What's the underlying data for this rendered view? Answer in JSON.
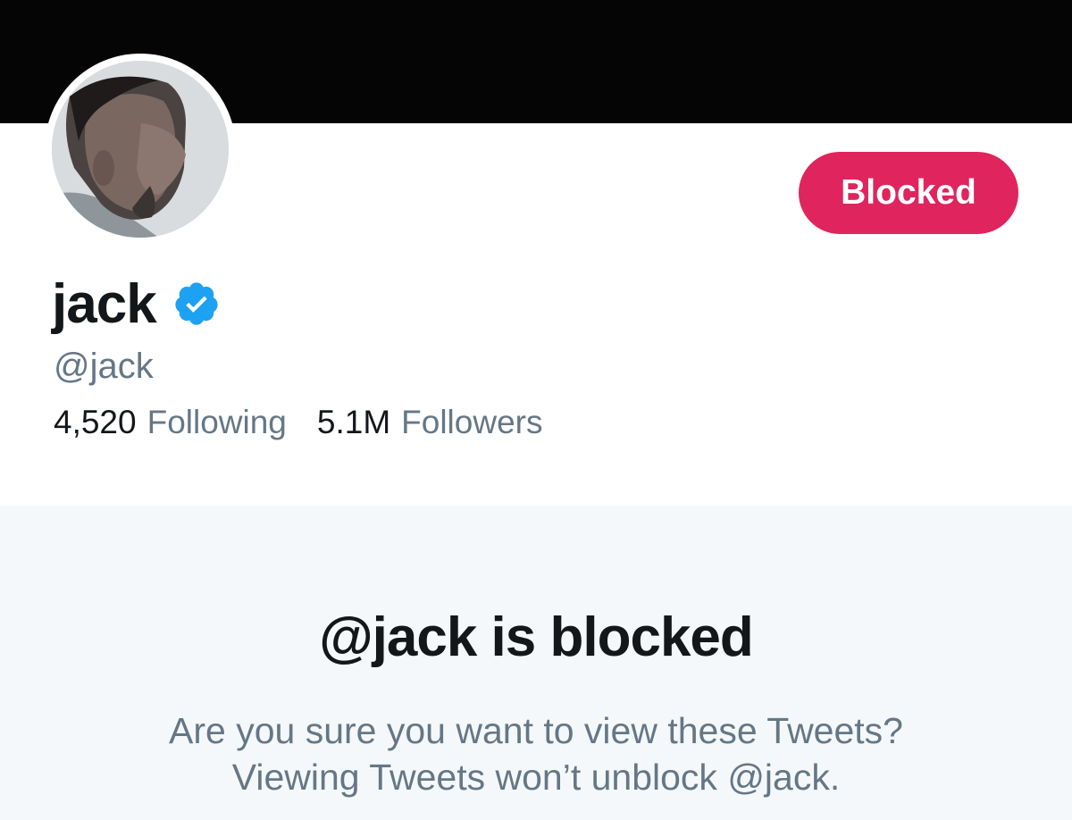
{
  "profile": {
    "display_name": "jack",
    "handle": "@jack",
    "verified": true,
    "following_count": "4,520",
    "following_label": "Following",
    "followers_count": "5.1M",
    "followers_label": "Followers"
  },
  "block_button": {
    "label": "Blocked",
    "color": "#e0245e"
  },
  "blocked_notice": {
    "title": "@jack is blocked",
    "line1": "Are you sure you want to view these Tweets?",
    "line2": "Viewing Tweets won’t unblock @jack."
  },
  "icons": {
    "verified": "verified-badge-icon"
  },
  "colors": {
    "banner": "#050505",
    "verified_blue": "#1da1f2",
    "primary_text": "#14171a",
    "secondary_text": "#657786",
    "panel_background": "#f5f8fa"
  }
}
